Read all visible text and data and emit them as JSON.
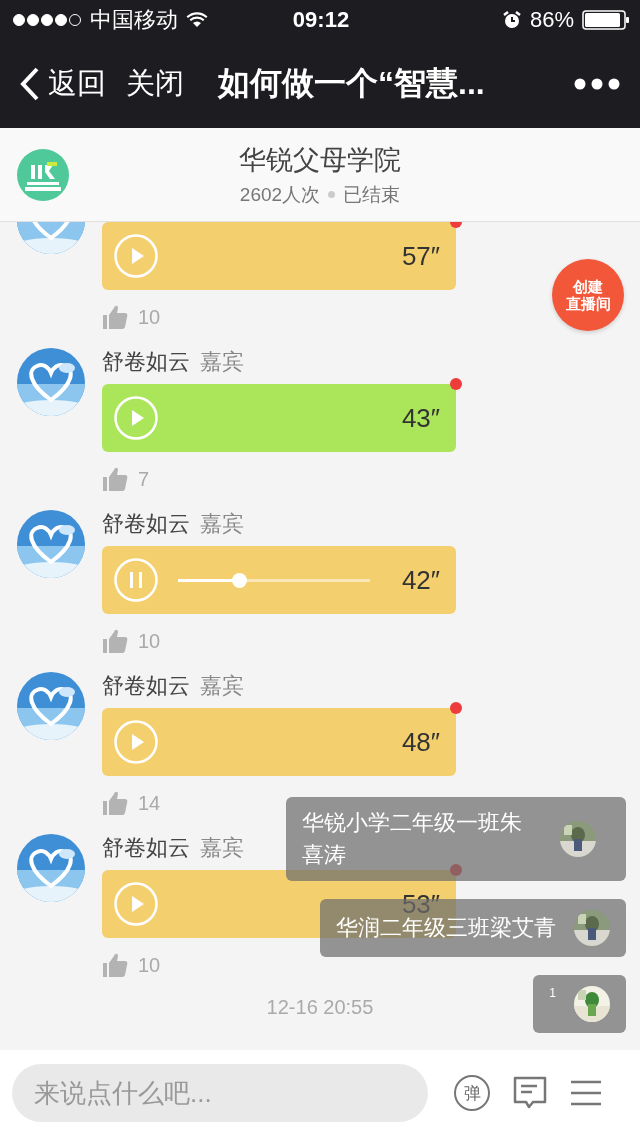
{
  "status_bar": {
    "carrier": "中国移动",
    "time": "09:12",
    "battery": "86%"
  },
  "nav": {
    "back": "返回",
    "close": "关闭",
    "title": "如何做一个“智慧..."
  },
  "header": {
    "name": "华锐父母学院",
    "views": "2602人次",
    "status": "已结束"
  },
  "create_button": {
    "lines": [
      "创建",
      "直播间"
    ]
  },
  "messages": [
    {
      "duration": "57″",
      "color": "#f4cf6e",
      "unread": true,
      "playing": false,
      "likes": "10"
    },
    {
      "name": "舒卷如云",
      "role": "嘉宾",
      "duration": "43″",
      "color": "#abe55a",
      "unread": true,
      "playing": false,
      "likes": "7"
    },
    {
      "name": "舒卷如云",
      "role": "嘉宾",
      "duration": "42″",
      "color": "#f4cf6e",
      "unread": false,
      "playing": true,
      "level": 0.32,
      "likes": "10"
    },
    {
      "name": "舒卷如云",
      "role": "嘉宾",
      "duration": "48″",
      "color": "#f4cf6e",
      "unread": true,
      "playing": false,
      "likes": "14"
    },
    {
      "name": "舒卷如云",
      "role": "嘉宾",
      "duration": "53″",
      "color": "#f4cf6e",
      "unread": true,
      "playing": false,
      "likes": "10"
    }
  ],
  "timestamp": "12-16 20:55",
  "danmaku": [
    {
      "text": "华锐小学二年级一班朱喜涛"
    },
    {
      "text": "华润二年级三班梁艾青"
    },
    {
      "text": "1"
    }
  ],
  "input": {
    "placeholder": "来说点什么吧..."
  },
  "danmaku_toggle": {
    "label": "弹"
  }
}
